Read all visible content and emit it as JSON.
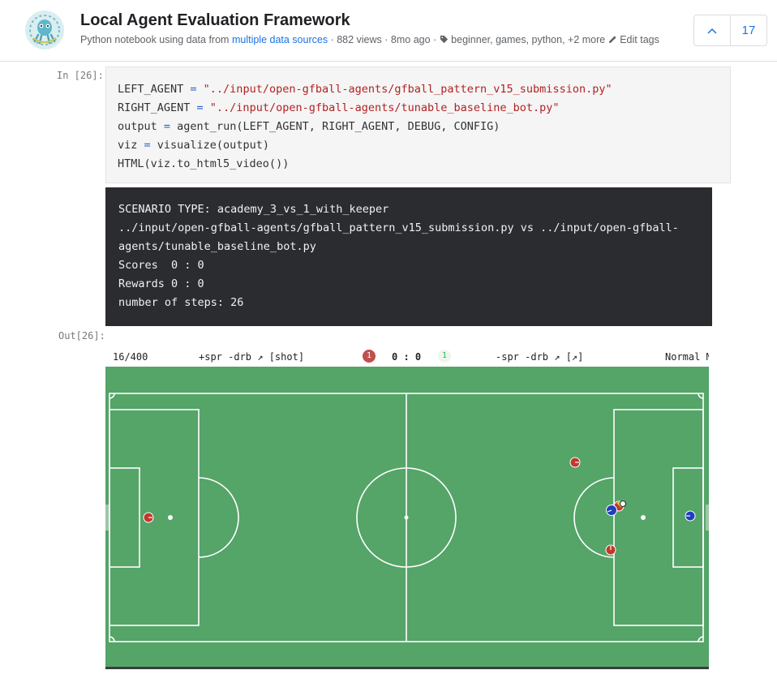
{
  "header": {
    "title": "Local Agent Evaluation Framework",
    "subtitle_prefix": "Python notebook using data from",
    "data_link": "multiple data sources",
    "views": "· 882 views",
    "age": "· 8mo ago ·",
    "tags": "beginner, games, python, +2 more",
    "edit_tags": "Edit tags",
    "vote_count": "17"
  },
  "cell": {
    "in_prompt": "In [26]:",
    "out_prompt": "Out[26]:",
    "code_lines": [
      {
        "name": "LEFT_AGENT",
        "op": " = ",
        "str": "\"../input/open-gfball-agents/gfball_pattern_v15_submission.py\""
      },
      {
        "name": "RIGHT_AGENT",
        "op": " = ",
        "str": "\"../input/open-gfball-agents/tunable_baseline_bot.py\""
      }
    ],
    "code_line3_lhs": "output",
    "code_line3_rhs": "agent_run(LEFT_AGENT, RIGHT_AGENT, DEBUG, CONFIG)",
    "code_line4_lhs": "viz",
    "code_line4_rhs": "visualize(output)",
    "code_line5": "HTML(viz.to_html5_video())",
    "eq": " = "
  },
  "output": {
    "lines": [
      "SCENARIO TYPE: academy_3_vs_1_with_keeper",
      "../input/open-gfball-agents/gfball_pattern_v15_submission.py vs ../input/open-gfball-",
      "agents/tunable_baseline_bot.py",
      "Scores  0 : 0",
      "Rewards 0 : 0",
      "number of steps: 26"
    ]
  },
  "video": {
    "step": "16/400",
    "left_actions": "+spr -drb ↗ [shot]",
    "left_badge": "1",
    "score": "0 : 0",
    "right_badge": "1",
    "right_actions": "-spr -drb ↗ [↗]",
    "mode": "Normal M",
    "field_color": "#55a468",
    "left_team_color": "#c0392b",
    "right_team_color": "#1f3fbf"
  }
}
